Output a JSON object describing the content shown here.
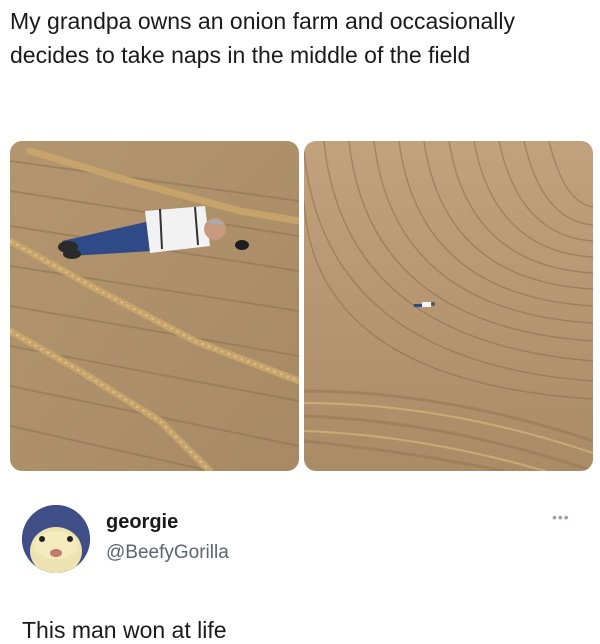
{
  "post": {
    "caption": "My grandpa owns an onion farm and occasionally decides to take naps in the middle of the field"
  },
  "images": [
    {
      "subject": "man in white shirt and jeans lying in onion field furrows, close view"
    },
    {
      "subject": "same man as a tiny figure in a large curved-furrow onion field, wide view"
    }
  ],
  "tweet": {
    "display_name": "georgie",
    "handle": "@BeefyGorilla",
    "text": "This man won at life",
    "more_icon": "ellipsis-icon",
    "avatar_icon": "avatar-creature-icon"
  },
  "colors": {
    "soil": "#b89a72",
    "soil_dark": "#8f7453",
    "stalks": "#c9a66b"
  }
}
